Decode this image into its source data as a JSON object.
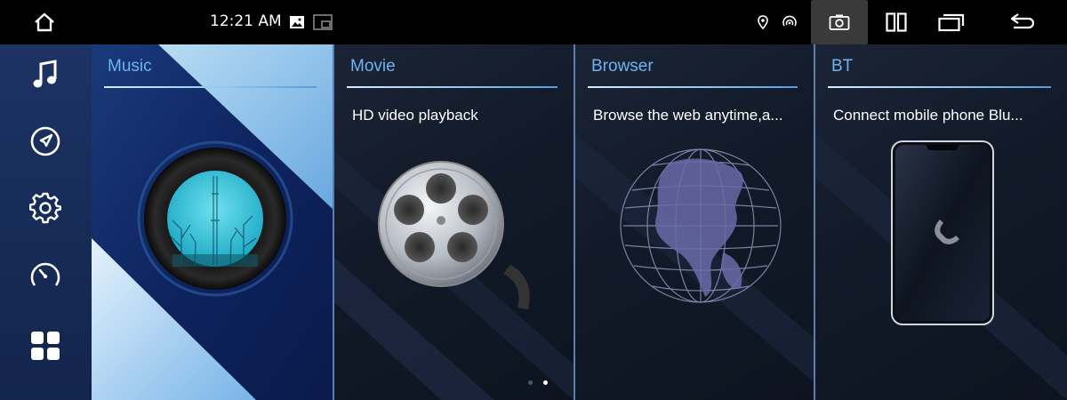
{
  "status_bar": {
    "time": "12:21 AM",
    "icons": [
      "home-icon",
      "image-icon",
      "picture-in-picture-icon",
      "location-icon",
      "hotspot-icon",
      "camera-icon",
      "split-screen-icon",
      "recent-apps-icon",
      "back-icon"
    ]
  },
  "sidebar": {
    "items": [
      {
        "icon": "music-note-icon"
      },
      {
        "icon": "navigation-icon"
      },
      {
        "icon": "settings-gear-icon"
      },
      {
        "icon": "speedometer-icon"
      },
      {
        "icon": "apps-grid-icon"
      }
    ]
  },
  "cards": {
    "music": {
      "title": "Music"
    },
    "movie": {
      "title": "Movie",
      "desc": "HD video playback"
    },
    "browser": {
      "title": "Browser",
      "desc": "Browse the web anytime,a..."
    },
    "bt": {
      "title": "BT",
      "desc": "Connect mobile phone Blu..."
    }
  },
  "pager": {
    "count": 2,
    "active": 2
  },
  "colors": {
    "accent": "#6cb4f0",
    "sidebar": "#1d3363",
    "camera_highlight": "#3a3a3a"
  }
}
